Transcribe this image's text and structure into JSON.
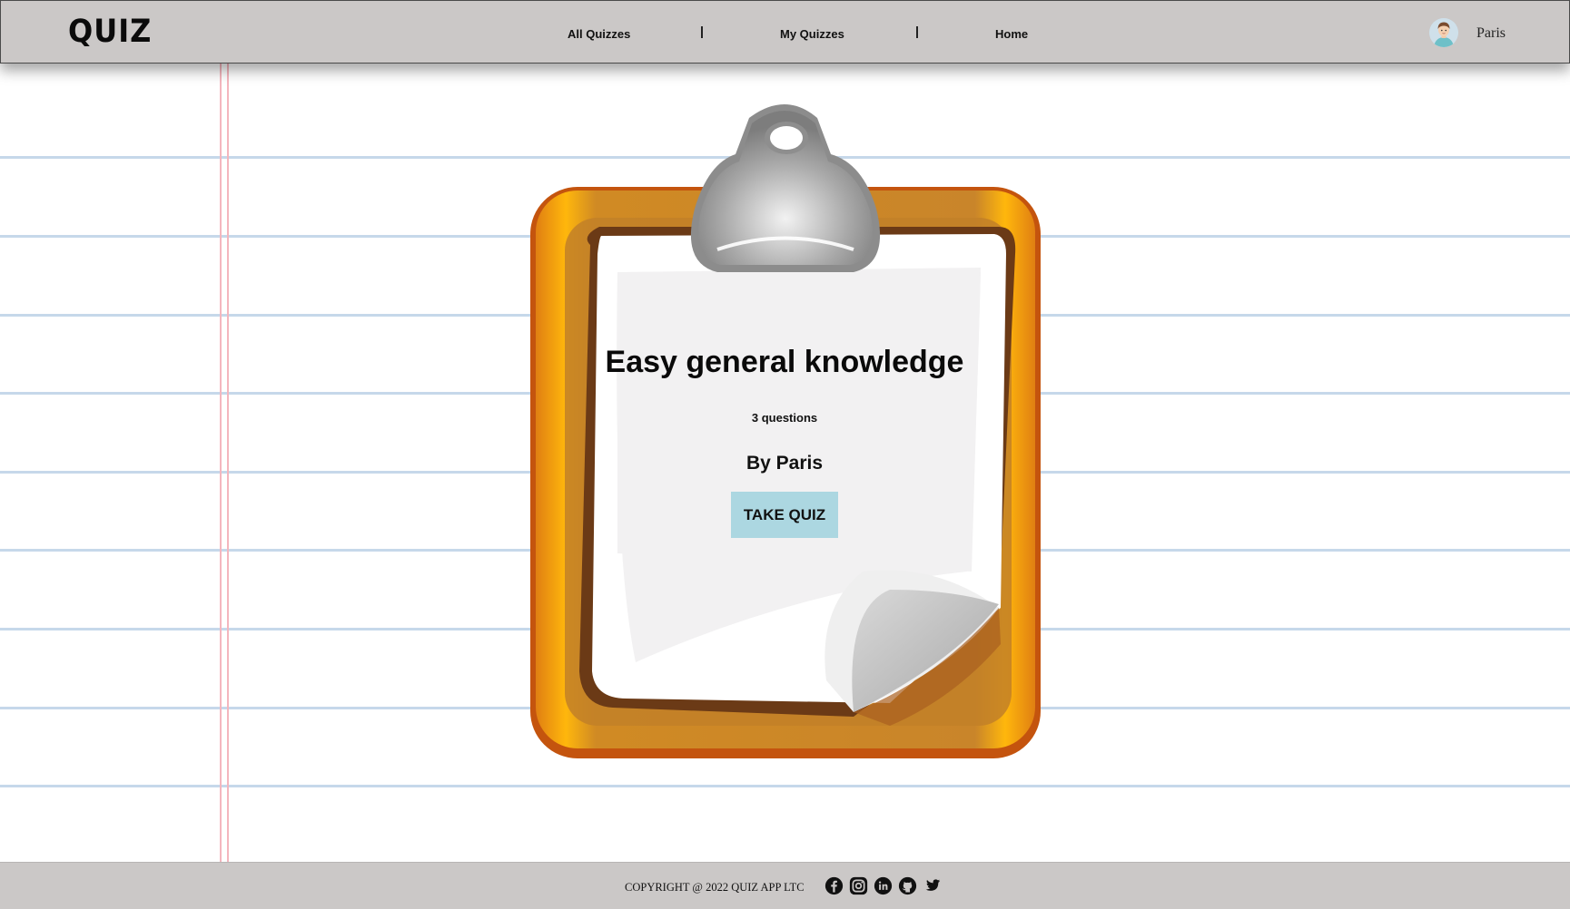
{
  "header": {
    "logo": "QUIZ",
    "nav": [
      {
        "label": "All Quizzes"
      },
      {
        "label": "My Quizzes"
      },
      {
        "label": "Home"
      }
    ],
    "nav_separator": "|",
    "user": {
      "name": "Paris",
      "avatar_icon": "user-avatar-icon"
    }
  },
  "quiz_card": {
    "title": "Easy general knowledge",
    "question_count": "3 questions",
    "author": "By Paris",
    "button_label": "TAKE QUIZ"
  },
  "footer": {
    "copyright": "COPYRIGHT @ 2022 QUIZ APP LTC",
    "social_icons": [
      "facebook-icon",
      "instagram-icon",
      "linkedin-icon",
      "github-icon",
      "twitter-icon"
    ]
  },
  "colors": {
    "header_bg": "#cbc8c7",
    "button_bg": "#acd7e1",
    "rule_line": "#c6d8ea",
    "margin_line": "#f4b6be",
    "clipboard_orange": "#f4a20f"
  }
}
